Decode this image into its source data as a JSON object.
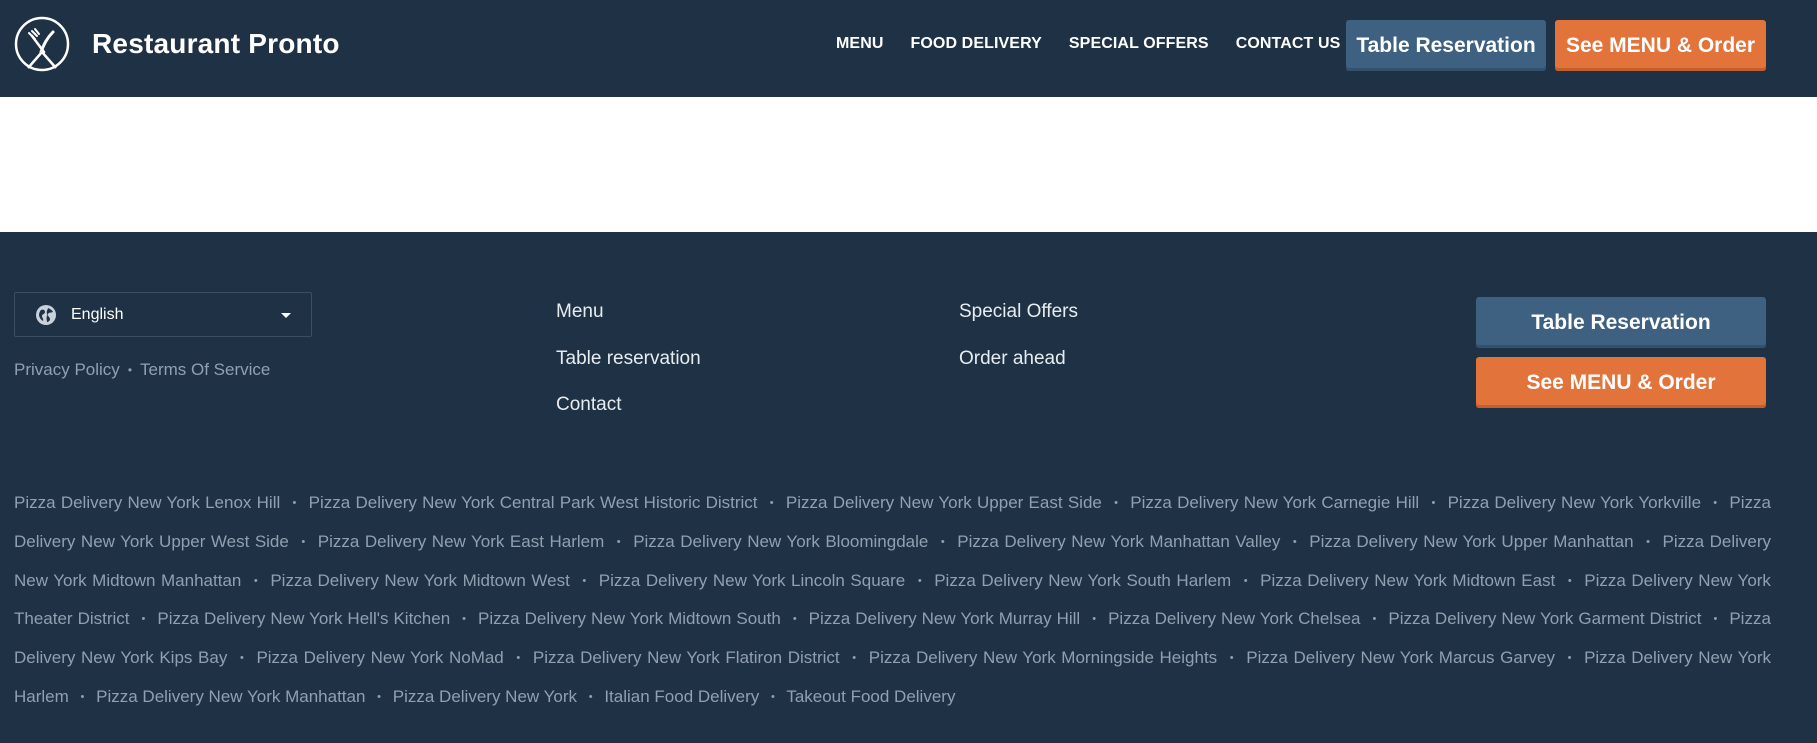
{
  "brand": {
    "name": "Restaurant Pronto",
    "logo_icon": "fork-knife-logo-icon"
  },
  "topnav": {
    "items": [
      "MENU",
      "FOOD DELIVERY",
      "SPECIAL OFFERS",
      "CONTACT US"
    ]
  },
  "header_buttons": {
    "reservation": "Table Reservation",
    "order": "See MENU & Order"
  },
  "footer": {
    "language": {
      "icon": "globe-icon",
      "selected": "English"
    },
    "legal": [
      "Privacy Policy",
      "Terms Of Service"
    ],
    "links_col1": [
      "Menu",
      "Table reservation",
      "Contact"
    ],
    "links_col2": [
      "Special Offers",
      "Order ahead"
    ],
    "buttons": {
      "reservation": "Table Reservation",
      "order": "See MENU & Order"
    },
    "areas": [
      "Pizza Delivery New York Lenox Hill",
      "Pizza Delivery New York Central Park West Historic District",
      "Pizza Delivery New York Upper East Side",
      "Pizza Delivery New York Carnegie Hill",
      "Pizza Delivery New York Yorkville",
      "Pizza Delivery New York Upper West Side",
      "Pizza Delivery New York East Harlem",
      "Pizza Delivery New York Bloomingdale",
      "Pizza Delivery New York Manhattan Valley",
      "Pizza Delivery New York Upper Manhattan",
      "Pizza Delivery New York Midtown Manhattan",
      "Pizza Delivery New York Midtown West",
      "Pizza Delivery New York Lincoln Square",
      "Pizza Delivery New York South Harlem",
      "Pizza Delivery New York Midtown East",
      "Pizza Delivery New York Theater District",
      "Pizza Delivery New York Hell's Kitchen",
      "Pizza Delivery New York Midtown South",
      "Pizza Delivery New York Murray Hill",
      "Pizza Delivery New York Chelsea",
      "Pizza Delivery New York Garment District",
      "Pizza Delivery New York Kips Bay",
      "Pizza Delivery New York NoMad",
      "Pizza Delivery New York Flatiron District",
      "Pizza Delivery New York Morningside Heights",
      "Pizza Delivery New York Marcus Garvey",
      "Pizza Delivery New York Harlem",
      "Pizza Delivery New York Manhattan",
      "Pizza Delivery New York",
      "Italian Food Delivery",
      "Takeout Food Delivery"
    ]
  },
  "colors": {
    "navy": "#1f3144",
    "blue_button": "#3e6181",
    "orange_button": "#e2733a",
    "muted_text": "#8fa0b1"
  }
}
